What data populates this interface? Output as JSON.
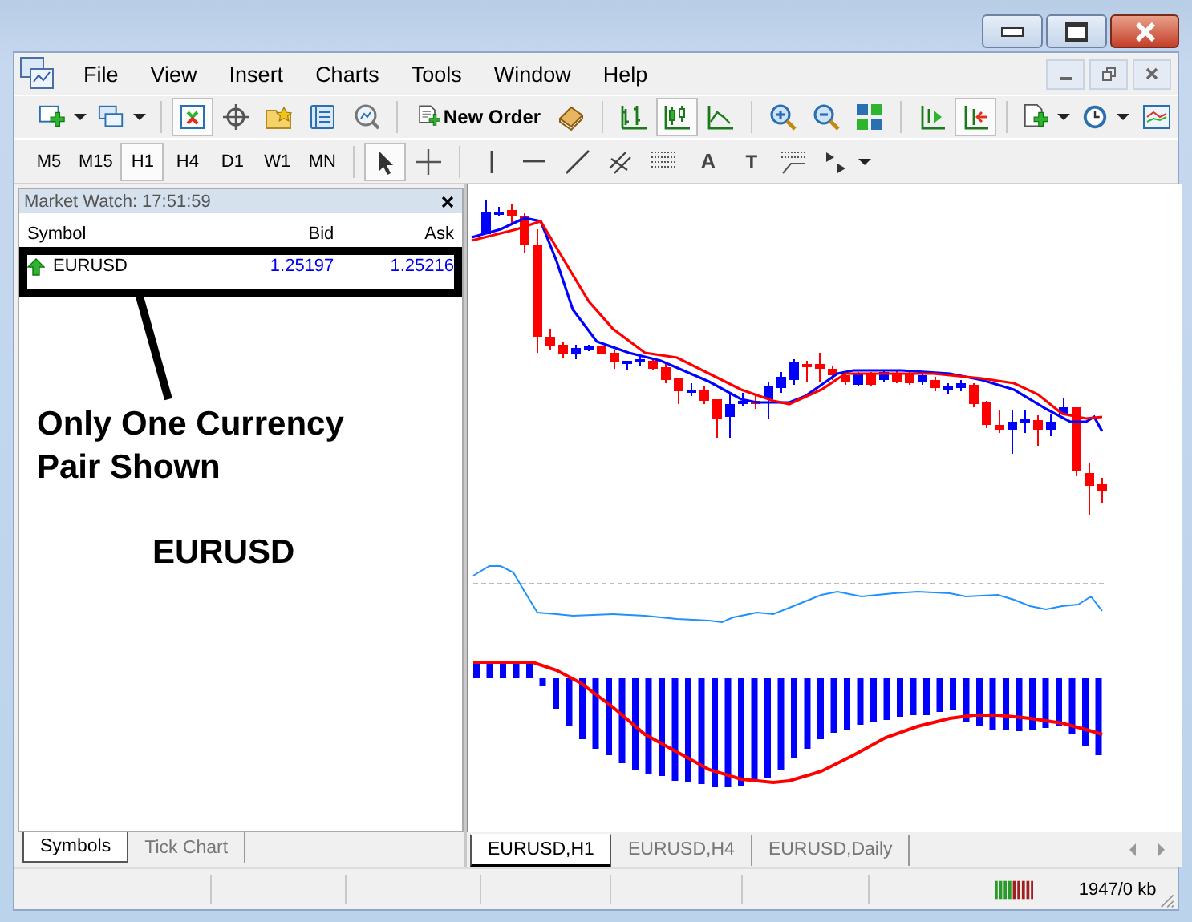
{
  "menu": [
    "File",
    "View",
    "Insert",
    "Charts",
    "Tools",
    "Window",
    "Help"
  ],
  "toolbar": [
    {
      "kind": "new-chart",
      "pressed": false,
      "caret": true
    },
    {
      "kind": "profiles",
      "pressed": false,
      "caret": true
    },
    {
      "kind": "sep"
    },
    {
      "kind": "market-watch",
      "pressed": true
    },
    {
      "kind": "crosshair",
      "pressed": false
    },
    {
      "kind": "favorites",
      "pressed": false
    },
    {
      "kind": "data-window",
      "pressed": false
    },
    {
      "kind": "tester",
      "pressed": false
    },
    {
      "kind": "sep"
    },
    {
      "kind": "new-order",
      "label": "New Order",
      "pressed": false
    },
    {
      "kind": "book",
      "pressed": false
    },
    {
      "kind": "sep"
    },
    {
      "kind": "bars",
      "pressed": false
    },
    {
      "kind": "candles",
      "pressed": true
    },
    {
      "kind": "line",
      "pressed": false
    },
    {
      "kind": "sep"
    },
    {
      "kind": "zoom-in",
      "pressed": false
    },
    {
      "kind": "zoom-out",
      "pressed": false
    },
    {
      "kind": "tile",
      "pressed": false
    },
    {
      "kind": "sep"
    },
    {
      "kind": "autoscroll",
      "pressed": false
    },
    {
      "kind": "shift",
      "pressed": true
    },
    {
      "kind": "sep"
    },
    {
      "kind": "indicators",
      "pressed": false,
      "caret": true
    },
    {
      "kind": "clock",
      "pressed": false,
      "caret": true
    },
    {
      "kind": "templates",
      "pressed": false
    }
  ],
  "timeframes": [
    {
      "label": "M5",
      "selected": false
    },
    {
      "label": "M15",
      "selected": false
    },
    {
      "label": "H1",
      "selected": true
    },
    {
      "label": "H4",
      "selected": false
    },
    {
      "label": "D1",
      "selected": false
    },
    {
      "label": "W1",
      "selected": false
    },
    {
      "label": "MN",
      "selected": false
    }
  ],
  "drawing_tools": [
    {
      "kind": "cursor",
      "pressed": true
    },
    {
      "kind": "cross",
      "pressed": false
    },
    {
      "kind": "sep"
    },
    {
      "kind": "vline",
      "pressed": false
    },
    {
      "kind": "hline",
      "pressed": false
    },
    {
      "kind": "trend",
      "pressed": false
    },
    {
      "kind": "channel",
      "pressed": false
    },
    {
      "kind": "fibo",
      "pressed": false
    },
    {
      "kind": "text",
      "label": "A",
      "pressed": false
    },
    {
      "kind": "label",
      "label": "T",
      "pressed": false
    },
    {
      "kind": "fan",
      "pressed": false
    },
    {
      "kind": "arrows",
      "pressed": false,
      "caret": true
    }
  ],
  "market_watch": {
    "title": "Market Watch: 17:51:59",
    "columns": [
      "Symbol",
      "Bid",
      "Ask"
    ],
    "rows": [
      {
        "symbol": "EURUSD",
        "bid": "1.25197",
        "ask": "1.25216",
        "rising": true
      }
    ]
  },
  "annotation": {
    "lines": [
      "Only One Currency",
      "Pair Shown"
    ],
    "symbol": "EURUSD"
  },
  "panel_tabs": [
    {
      "label": "Symbols",
      "selected": true
    },
    {
      "label": "Tick Chart",
      "selected": false
    }
  ],
  "chart_tabs": [
    {
      "label": "EURUSD,H1",
      "selected": true
    },
    {
      "label": "EURUSD,H4",
      "selected": false
    },
    {
      "label": "EURUSD,Daily",
      "selected": false
    }
  ],
  "status_bar": {
    "traffic": "1947/0 kb"
  }
}
